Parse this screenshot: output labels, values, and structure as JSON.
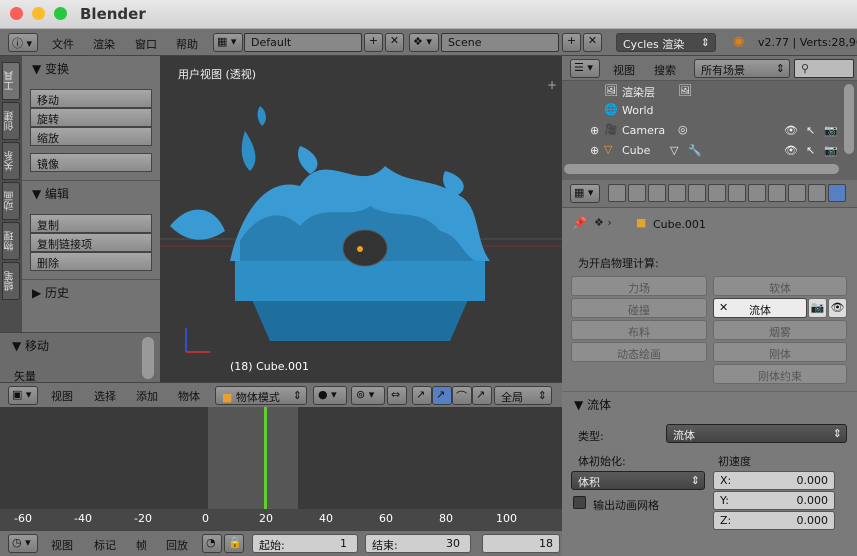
{
  "window": {
    "title": "Blender"
  },
  "menu": {
    "info_icon": "info-icon",
    "file": "文件",
    "render": "渲染",
    "window": "窗口",
    "help": "帮助",
    "layout": "Default",
    "scene": "Scene",
    "engine": "Cycles 渲染",
    "version": "v2.77 | Verts:28,96"
  },
  "side_tabs": [
    "工具",
    "创建",
    "关系",
    "动画",
    "物理",
    "蜡笔"
  ],
  "tools": {
    "transform_header": "▼ 变换",
    "move": "移动",
    "rotate": "旋转",
    "scale": "缩放",
    "mirror": "镜像",
    "edit_header": "▼ 编辑",
    "duplicate": "复制",
    "duplicate_linked": "复制链接项",
    "delete": "删除",
    "history_header": "▶ 历史"
  },
  "operator": {
    "header": "▼ 移动",
    "vector_label": "矢量"
  },
  "viewport": {
    "title": "用户视图 (透视)",
    "object_label": "(18) Cube.001"
  },
  "viewport_header": {
    "view": "视图",
    "select": "选择",
    "add": "添加",
    "object": "物体",
    "mode": "物体模式",
    "orientation": "全局"
  },
  "timeline": {
    "ticks": [
      "-60",
      "-40",
      "-20",
      "0",
      "20",
      "40",
      "60",
      "80",
      "100"
    ],
    "current_frame": 20
  },
  "bottom": {
    "view": "视图",
    "marker": "标记",
    "frame": "帧",
    "playback": "回放",
    "start_label": "起始:",
    "start_value": "1",
    "end_label": "结束:",
    "end_value": "30",
    "current": "18"
  },
  "outliner": {
    "view": "视图",
    "search": "搜索",
    "scope": "所有场景",
    "rows": [
      {
        "label": "渲染层"
      },
      {
        "label": "World"
      },
      {
        "label": "Camera"
      },
      {
        "label": "Cube"
      }
    ]
  },
  "properties": {
    "object_name": "Cube.001",
    "enable_label": "为开启物理计算:",
    "left_buttons": [
      "力场",
      "碰撞",
      "布料",
      "动态绘画"
    ],
    "right_buttons": [
      "软体",
      "流体",
      "烟雾",
      "刚体",
      "刚体约束"
    ],
    "fluid_header": "▼ 流体",
    "type_label": "类型:",
    "type_value": "流体",
    "init_label": "体初始化:",
    "init_value": "体积",
    "velocity_label": "初速度",
    "export_label": "输出动画网格",
    "vx_label": "X:",
    "vx": "0.000",
    "vy_label": "Y:",
    "vy": "0.000",
    "vz_label": "Z:",
    "vz": "0.000"
  }
}
